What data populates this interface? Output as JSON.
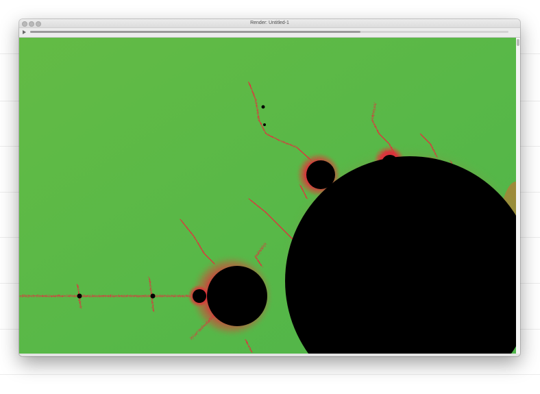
{
  "window": {
    "title": "Render: Untitled-1"
  },
  "playback": {
    "progress": 0.69
  },
  "canvas": {
    "background_color": "#58b847",
    "set_color": "#000000",
    "edge_color": "#e8243a"
  },
  "icons": {
    "play": "play-icon"
  }
}
